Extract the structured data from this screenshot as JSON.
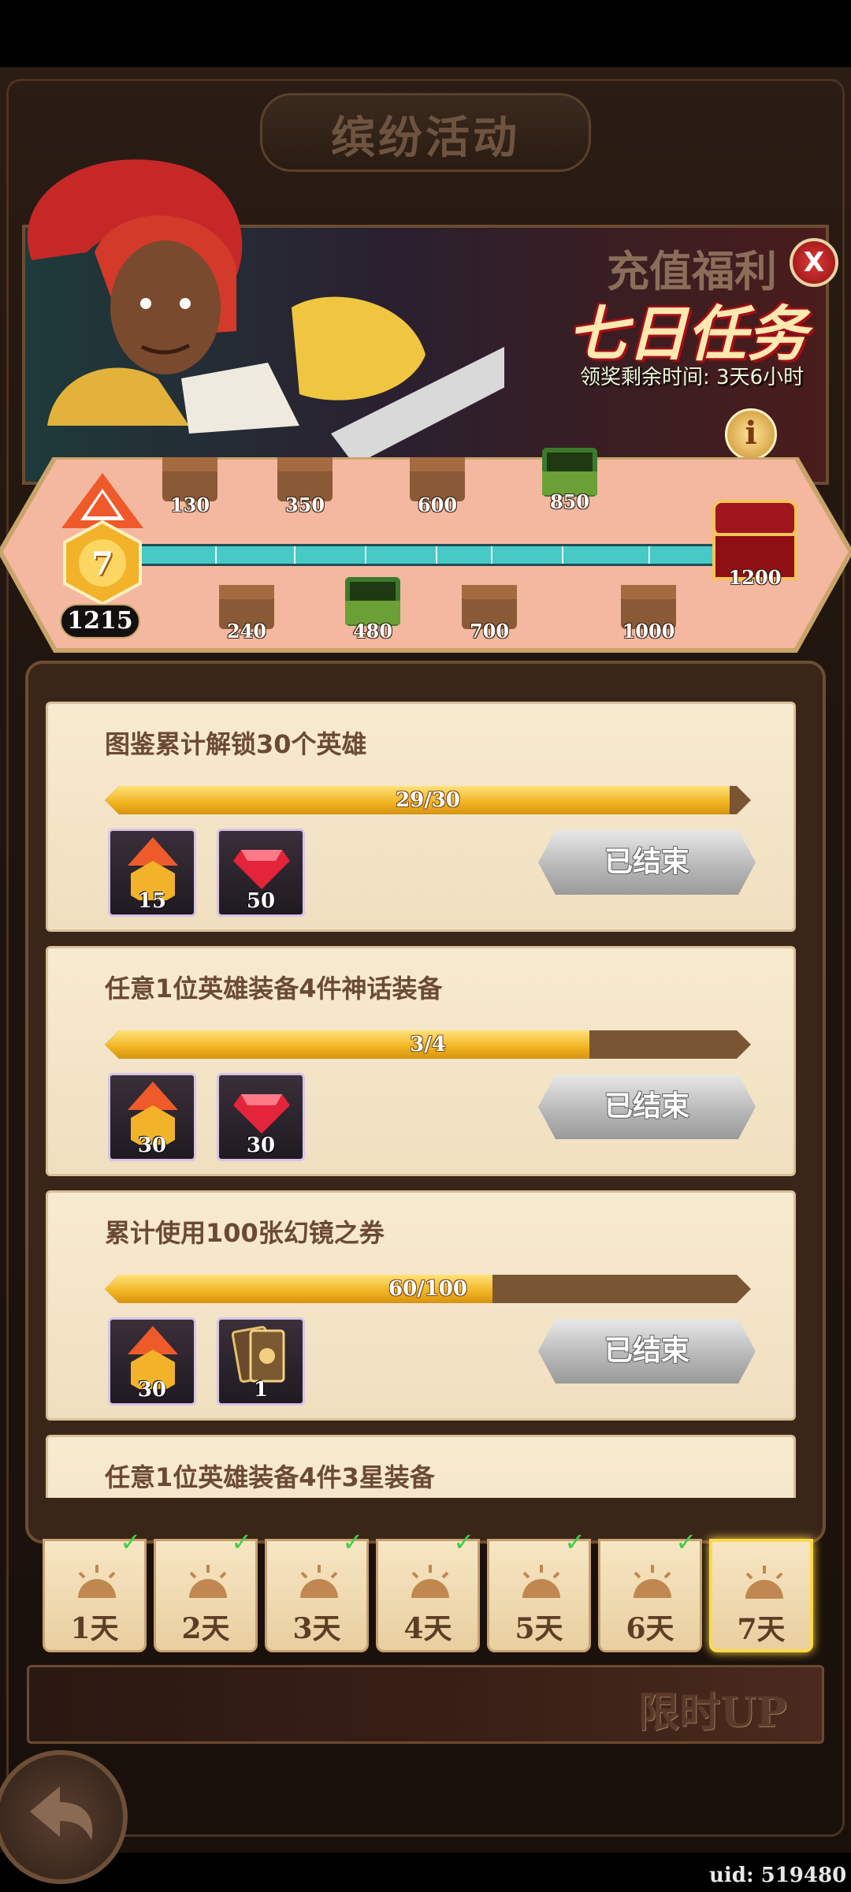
{
  "header": {
    "title": "缤纷活动"
  },
  "banner": {
    "title_small": "充值福利",
    "title_big": "七日任务",
    "time_left": "领奖剩余时间: 3天6小时",
    "close_label": "X",
    "info_label": "i"
  },
  "progress": {
    "level": "7",
    "points": "1215",
    "chests_top": [
      {
        "value": "130",
        "opened": false
      },
      {
        "value": "350",
        "opened": false
      },
      {
        "value": "600",
        "opened": false
      },
      {
        "value": "850",
        "opened": true
      }
    ],
    "chests_bottom": [
      {
        "value": "240",
        "opened": false
      },
      {
        "value": "480",
        "opened": true
      },
      {
        "value": "700",
        "opened": false
      },
      {
        "value": "1000",
        "opened": false
      }
    ],
    "final_chest": "1200"
  },
  "tasks": [
    {
      "title": "图鉴累计解锁30个英雄",
      "progress_text": "29/30",
      "progress": 0.967,
      "rewards": [
        {
          "icon": "medal-icon",
          "count": "15"
        },
        {
          "icon": "ruby-icon",
          "count": "50"
        }
      ],
      "button": "已结束"
    },
    {
      "title": "任意1位英雄装备4件神话装备",
      "progress_text": "3/4",
      "progress": 0.75,
      "rewards": [
        {
          "icon": "medal-icon",
          "count": "30"
        },
        {
          "icon": "ruby-icon",
          "count": "30"
        }
      ],
      "button": "已结束"
    },
    {
      "title": "累计使用100张幻镜之券",
      "progress_text": "60/100",
      "progress": 0.6,
      "rewards": [
        {
          "icon": "medal-icon",
          "count": "30"
        },
        {
          "icon": "card-icon",
          "count": "1"
        }
      ],
      "button": "已结束"
    },
    {
      "title": "任意1位英雄装备4件3星装备"
    }
  ],
  "days": [
    {
      "label": "1天",
      "completed": true
    },
    {
      "label": "2天",
      "completed": true
    },
    {
      "label": "3天",
      "completed": true
    },
    {
      "label": "4天",
      "completed": true
    },
    {
      "label": "5天",
      "completed": true
    },
    {
      "label": "6天",
      "completed": true
    },
    {
      "label": "7天",
      "completed": false,
      "selected": true
    }
  ],
  "check_mark": "✓",
  "bottom_banner": {
    "text": "限时UP"
  },
  "footer": {
    "uid": "uid: 519480"
  },
  "colors": {
    "accent_gold": "#f0b320",
    "progress_bg": "#7a5534",
    "track_teal": "#47c9c6",
    "close_red": "#e23a3a",
    "tab_active_glow": "#ffd84a"
  }
}
